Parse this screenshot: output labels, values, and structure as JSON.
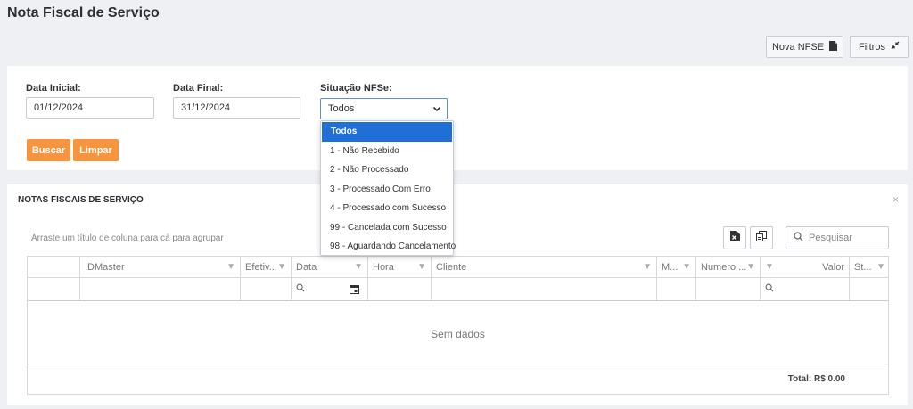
{
  "page": {
    "title": "Nota Fiscal de Serviço"
  },
  "toolbar": {
    "new_nfse": "Nova NFSE",
    "filters": "Filtros"
  },
  "filters": {
    "start_label": "Data Inicial:",
    "start_value": "01/12/2024",
    "end_label": "Data Final:",
    "end_value": "31/12/2024",
    "status_label": "Situação NFSe:",
    "status_value": "Todos",
    "search_btn": "Buscar",
    "clear_btn": "Limpar"
  },
  "dropdown": {
    "options": [
      "Todos",
      "1 - Não Recebido",
      "2 - Não Processado",
      "3 - Processado Com Erro",
      "4 - Processado com Sucesso",
      "99 - Cancelada com Sucesso",
      "98 - Aguardando Cancelamento"
    ],
    "selected_index": 0
  },
  "grid": {
    "title": "NOTAS FISCAIS DE SERVIÇO",
    "group_hint": "Arraste um título de coluna para cá para agrupar",
    "search_placeholder": "Pesquisar",
    "columns": [
      "IDMaster",
      "Efetiv...",
      "Data",
      "Hora",
      "Cliente",
      "M...",
      "Numero ...",
      "Valor",
      "St..."
    ],
    "empty_text": "Sem dados",
    "total": "Total: R$ 0.00"
  },
  "colors": {
    "accent": "#f7943e",
    "select_blue": "#1f6fd6"
  }
}
